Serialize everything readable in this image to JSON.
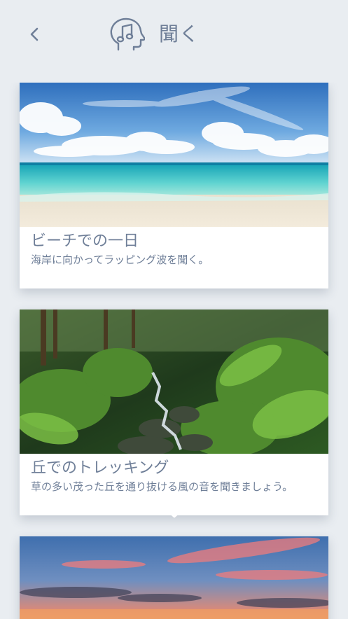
{
  "header": {
    "title": "聞く",
    "back_icon": "chevron-left-icon",
    "head_icon": "head-music-note-icon"
  },
  "cards": [
    {
      "title": "ビーチでの一日",
      "description": "海岸に向かってラッピング波を聞く。",
      "image": "beach-image"
    },
    {
      "title": "丘でのトレッキング",
      "description": "草の多い茂った丘を通り抜ける風の音を聞きましょう。",
      "image": "forest-waterfall-image"
    },
    {
      "title": "",
      "description": "",
      "image": "sunset-sky-image"
    }
  ],
  "scroll_indicator_icon": "chevron-down-icon",
  "colors": {
    "background": "#e9edf1",
    "text": "#6f7f98",
    "card": "#ffffff"
  }
}
